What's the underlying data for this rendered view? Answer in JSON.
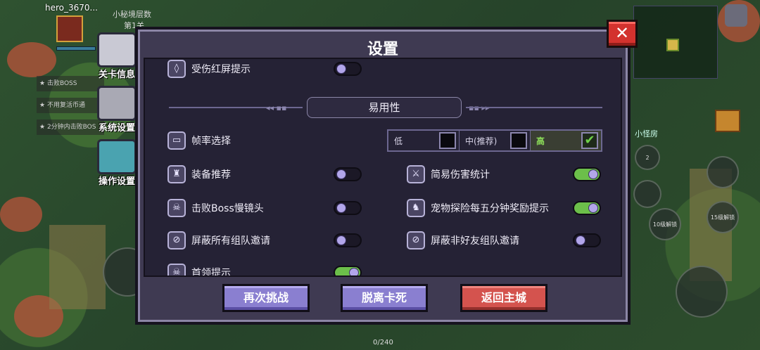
{
  "colors": {
    "dialog_bg": "#3f3a52",
    "panel_bg": "#252235",
    "toggle_on": "#6cbf4a",
    "close_red": "#d3322e",
    "button_purple": "#8a7fd0",
    "button_red": "#d4534e",
    "fps_active": "#8ee05a"
  },
  "hud": {
    "player_name": "hero_3670...",
    "layer_label": "小秘境层数",
    "layer_value": "第1关",
    "quests": [
      "击败BOSS",
      "不用复活币通",
      "2分钟内击败BOS"
    ],
    "side_tabs": [
      {
        "label": "关卡信息",
        "icon": "skull-icon"
      },
      {
        "label": "系统设置",
        "icon": "wrench-icon"
      },
      {
        "label": "操作设置",
        "icon": "gamepad-icon"
      }
    ],
    "right_label": "小怪房",
    "skill_badge": "2",
    "skill_lock_1": "10级解锁",
    "skill_lock_2": "15级解锁",
    "xp_text": "0/240"
  },
  "dialog": {
    "title": "设置",
    "close_icon": "close-icon",
    "settings_top": {
      "label": "受伤红屏提示",
      "icon": "droplet-icon",
      "on": false
    },
    "section_title": "易用性",
    "fps": {
      "label": "帧率选择",
      "icon": "fps-icon",
      "options": [
        {
          "label": "低",
          "checked": false
        },
        {
          "label": "中(推荐)",
          "checked": false
        },
        {
          "label": "高",
          "checked": true
        }
      ]
    },
    "settings_left": [
      {
        "label": "装备推荐",
        "icon": "armor-icon",
        "on": false
      },
      {
        "label": "击败Boss慢镜头",
        "icon": "boss-icon",
        "on": false
      },
      {
        "label": "屏蔽所有组队邀请",
        "icon": "block-team-icon",
        "on": false
      },
      {
        "label": "首领提示",
        "icon": "boss-alert-icon",
        "on": true
      }
    ],
    "settings_right": [
      {
        "label": "简易伤害统计",
        "icon": "sword-icon",
        "on": true
      },
      {
        "label": "宠物探险每五分钟奖励提示",
        "icon": "pet-icon",
        "on": true
      },
      {
        "label": "屏蔽非好友组队邀请",
        "icon": "block-friend-icon",
        "on": false
      }
    ],
    "buttons": [
      {
        "label": "再次挑战",
        "style": "purple"
      },
      {
        "label": "脱离卡死",
        "style": "purple"
      },
      {
        "label": "返回主城",
        "style": "red"
      }
    ]
  }
}
